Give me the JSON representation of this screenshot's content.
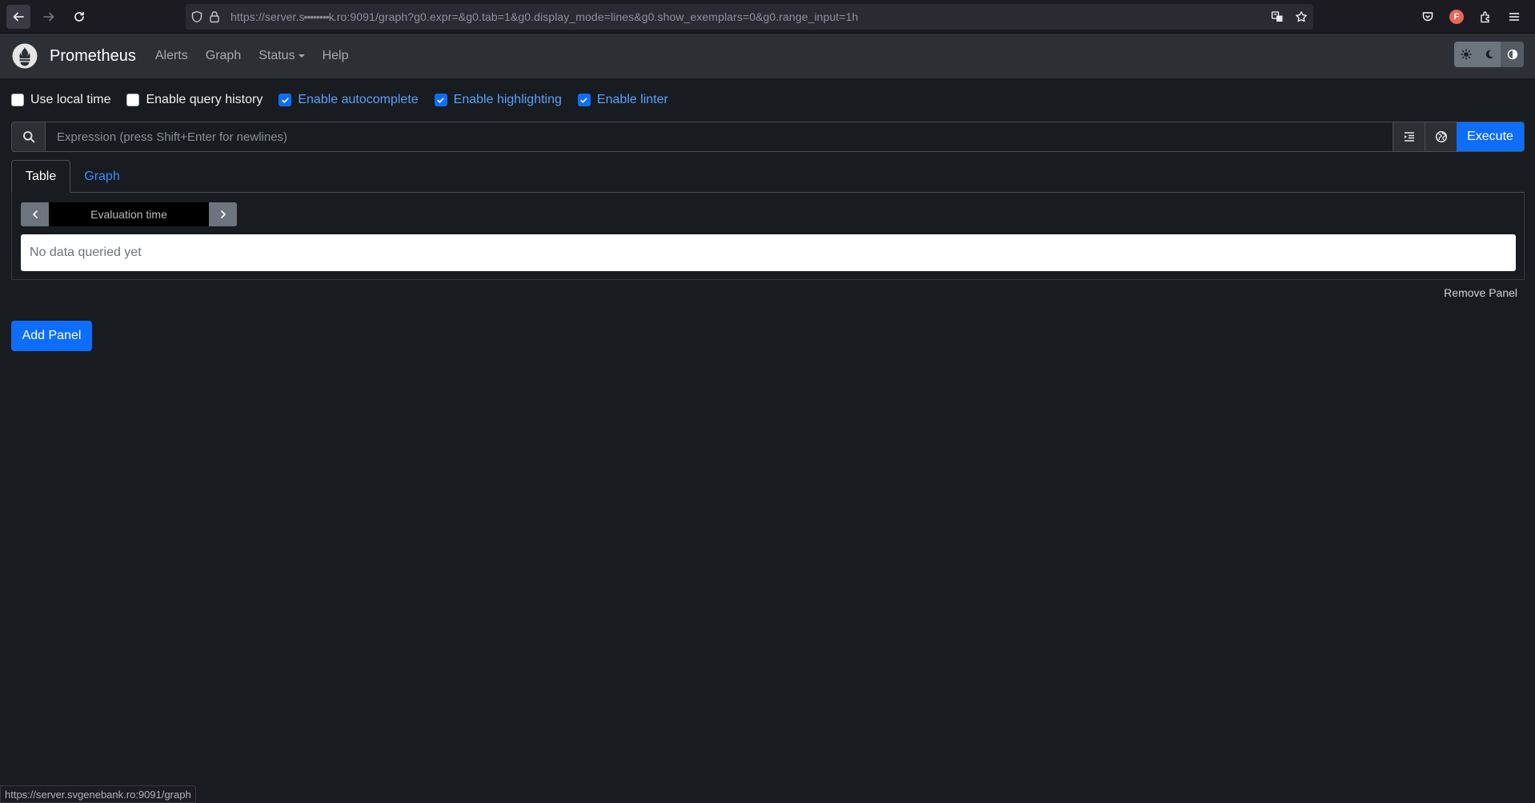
{
  "browser": {
    "url_prefix": "https://server.",
    "url_redacted": "s••••••••k",
    "url_suffix": ".ro:9091/graph?g0.expr=&g0.tab=1&g0.display_mode=lines&g0.show_exemplars=0&g0.range_input=1h",
    "profile_initial": "F"
  },
  "navbar": {
    "brand": "Prometheus",
    "links": [
      "Alerts",
      "Graph",
      "Status",
      "Help"
    ]
  },
  "options": [
    {
      "label": "Use local time",
      "checked": false
    },
    {
      "label": "Enable query history",
      "checked": false
    },
    {
      "label": "Enable autocomplete",
      "checked": true
    },
    {
      "label": "Enable highlighting",
      "checked": true
    },
    {
      "label": "Enable linter",
      "checked": true
    }
  ],
  "query": {
    "placeholder": "Expression (press Shift+Enter for newlines)",
    "value": "",
    "execute_label": "Execute"
  },
  "panel": {
    "tabs": [
      "Table",
      "Graph"
    ],
    "active_tab": "Table",
    "eval_time_placeholder": "Evaluation time",
    "no_data": "No data queried yet",
    "remove_label": "Remove Panel"
  },
  "add_panel_label": "Add Panel",
  "status_bar_url": "https://server.svgenebank.ro:9091/graph",
  "colors": {
    "page_bg": "#181b1f",
    "navbar_bg": "#2c3035",
    "primary": "#0d6efd"
  }
}
